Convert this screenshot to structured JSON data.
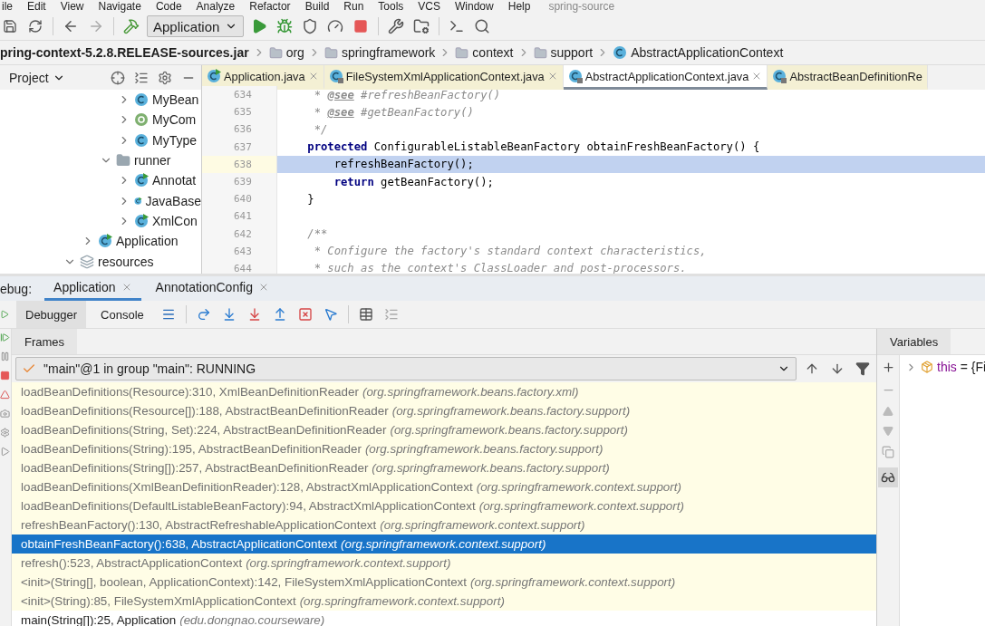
{
  "menu": {
    "items": [
      "ile",
      "Edit",
      "View",
      "Navigate",
      "Code",
      "Analyze",
      "Refactor",
      "Build",
      "Run",
      "Tools",
      "VCS",
      "Window",
      "Help"
    ],
    "title": "spring-source"
  },
  "toolbar": {
    "run_config": "Application"
  },
  "breadcrumbs": [
    {
      "label": "pring-context-5.2.8.RELEASE-sources.jar",
      "kind": "jar"
    },
    {
      "label": "org",
      "kind": "folder"
    },
    {
      "label": "springframework",
      "kind": "folder"
    },
    {
      "label": "context",
      "kind": "folder"
    },
    {
      "label": "support",
      "kind": "folder"
    },
    {
      "label": "AbstractApplicationContext",
      "kind": "class"
    }
  ],
  "project": {
    "title": "Project",
    "tree": [
      {
        "children": [
          {
            "children": [
              {
                "children": [
                  {
                    "label": "MyBean",
                    "kind": "class",
                    "expanded": false
                  },
                  {
                    "label": "MyCom",
                    "kind": "annotation",
                    "expanded": false
                  },
                  {
                    "label": "MyType",
                    "kind": "class",
                    "expanded": false
                  }
                ]
              },
              {
                "label": "runner",
                "kind": "folder",
                "expanded": true,
                "children": [
                  {
                    "label": "Annotat",
                    "kind": "runnable",
                    "expanded": false
                  },
                  {
                    "label": "JavaBase",
                    "kind": "runnable",
                    "expanded": false
                  },
                  {
                    "label": "XmlCon",
                    "kind": "runnable",
                    "expanded": false
                  }
                ]
              }
            ]
          },
          {
            "label": "Application",
            "kind": "runnable",
            "expanded": false
          }
        ]
      },
      {
        "label": "resources",
        "kind": "resources",
        "expanded": true
      }
    ]
  },
  "editor": {
    "tabs": [
      {
        "label": "Application.java",
        "kind": "runnable",
        "selected": false
      },
      {
        "label": "FileSystemXmlApplicationContext.java",
        "kind": "library",
        "selected": false
      },
      {
        "label": "AbstractApplicationContext.java",
        "kind": "library",
        "selected": true
      },
      {
        "label": "AbstractBeanDefinitionRe",
        "kind": "library",
        "selected": false
      }
    ],
    "lines": [
      {
        "number": "634",
        "highlighted": false,
        "tokens": [
          {
            "text": "     * ",
            "kind": "comment"
          },
          {
            "text": "@see",
            "kind": "doc_tag"
          },
          {
            "text": " #refreshBeanFactory()",
            "kind": "comment"
          }
        ]
      },
      {
        "number": "635",
        "highlighted": false,
        "tokens": [
          {
            "text": "     * ",
            "kind": "comment"
          },
          {
            "text": "@see",
            "kind": "doc_tag"
          },
          {
            "text": " #getBeanFactory()",
            "kind": "comment"
          }
        ]
      },
      {
        "number": "636",
        "highlighted": false,
        "tokens": [
          {
            "text": "     */",
            "kind": "comment"
          }
        ]
      },
      {
        "number": "637",
        "highlighted": false,
        "tokens": [
          {
            "text": "    protected",
            "kind": "keyword"
          },
          {
            "text": " ConfigurableListableBeanFactory obtainFreshBeanFactory() {",
            "kind": "plain"
          }
        ]
      },
      {
        "number": "638",
        "highlighted": true,
        "tokens": [
          {
            "text": "        refreshBeanFactory();",
            "kind": "plain"
          }
        ]
      },
      {
        "number": "639",
        "highlighted": false,
        "tokens": [
          {
            "text": "        return",
            "kind": "keyword"
          },
          {
            "text": " getBeanFactory();",
            "kind": "plain"
          }
        ]
      },
      {
        "number": "640",
        "highlighted": false,
        "tokens": [
          {
            "text": "    }",
            "kind": "plain"
          }
        ]
      },
      {
        "number": "641",
        "highlighted": false
      },
      {
        "number": "642",
        "highlighted": false,
        "tokens": [
          {
            "text": "    /**",
            "kind": "comment"
          }
        ]
      },
      {
        "number": "643",
        "highlighted": false,
        "tokens": [
          {
            "text": "     * Configure the factory's standard context characteristics,",
            "kind": "comment"
          }
        ]
      },
      {
        "number": "644",
        "highlighted": false,
        "tokens": [
          {
            "text": "     * such as the context's ClassLoader and post-processors.",
            "kind": "comment"
          }
        ]
      }
    ]
  },
  "debug": {
    "label": "ebug:",
    "tabs": [
      {
        "label": "Application",
        "selected": true
      },
      {
        "label": "AnnotationConfig",
        "selected": false
      }
    ],
    "subtabs": [
      {
        "label": "Debugger",
        "selected": true
      },
      {
        "label": "Console",
        "selected": false
      }
    ],
    "frames_title": "Frames",
    "variables_title": "Variables",
    "thread": "\"main\"@1 in group \"main\": RUNNING",
    "frames": [
      {
        "method": "loadBeanDefinitions(Resource):310, XmlBeanDefinitionReader",
        "package": "(org.springframework.beans.factory.xml)",
        "kind": "library",
        "selected": false
      },
      {
        "method": "loadBeanDefinitions(Resource[]):188, AbstractBeanDefinitionReader",
        "package": "(org.springframework.beans.factory.support)",
        "kind": "library",
        "selected": false
      },
      {
        "method": "loadBeanDefinitions(String, Set):224, AbstractBeanDefinitionReader",
        "package": "(org.springframework.beans.factory.support)",
        "kind": "library",
        "selected": false
      },
      {
        "method": "loadBeanDefinitions(String):195, AbstractBeanDefinitionReader",
        "package": "(org.springframework.beans.factory.support)",
        "kind": "library",
        "selected": false
      },
      {
        "method": "loadBeanDefinitions(String[]):257, AbstractBeanDefinitionReader",
        "package": "(org.springframework.beans.factory.support)",
        "kind": "library",
        "selected": false
      },
      {
        "method": "loadBeanDefinitions(XmlBeanDefinitionReader):128, AbstractXmlApplicationContext",
        "package": "(org.springframework.context.support)",
        "kind": "library",
        "selected": false
      },
      {
        "method": "loadBeanDefinitions(DefaultListableBeanFactory):94, AbstractXmlApplicationContext",
        "package": "(org.springframework.context.support)",
        "kind": "library",
        "selected": false
      },
      {
        "method": "refreshBeanFactory():130, AbstractRefreshableApplicationContext",
        "package": "(org.springframework.context.support)",
        "kind": "library",
        "selected": false
      },
      {
        "method": "obtainFreshBeanFactory():638, AbstractApplicationContext",
        "package": "(org.springframework.context.support)",
        "kind": "library",
        "selected": true
      },
      {
        "method": "refresh():523, AbstractApplicationContext",
        "package": "(org.springframework.context.support)",
        "kind": "library",
        "selected": false
      },
      {
        "method": "<init>(String[], boolean, ApplicationContext):142, FileSystemXmlApplicationContext",
        "package": "(org.springframework.context.support)",
        "kind": "library",
        "selected": false
      },
      {
        "method": "<init>(String):85, FileSystemXmlApplicationContext",
        "package": "(org.springframework.context.support)",
        "kind": "library",
        "selected": false
      },
      {
        "method": "main(String[]):25, Application",
        "package": "(edu.dongnao.courseware)",
        "kind": "user",
        "selected": false
      }
    ],
    "variables": [
      {
        "name": "this",
        "value": "= {Fi"
      }
    ]
  }
}
